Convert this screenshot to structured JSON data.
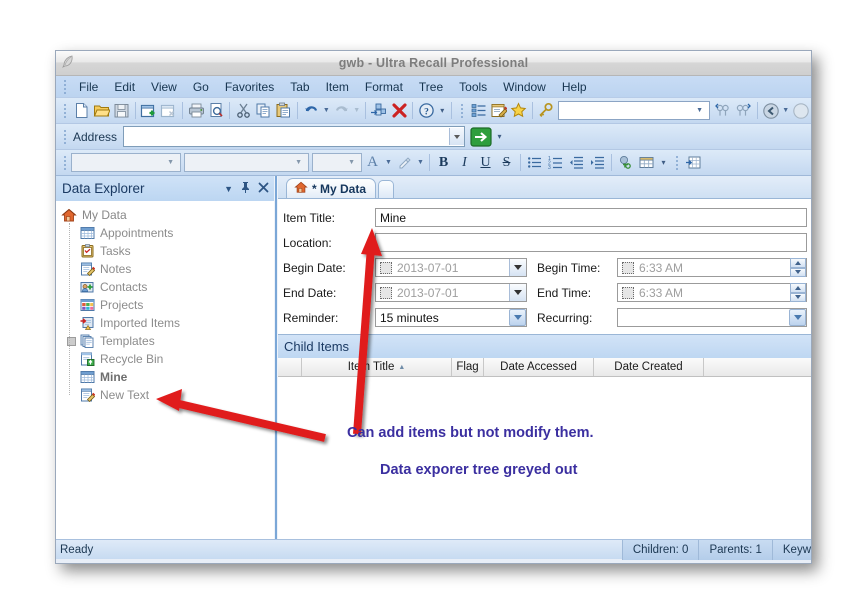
{
  "window": {
    "title": "gwb - Ultra Recall Professional",
    "app_icon": "feather-icon"
  },
  "menubar": {
    "items": [
      "File",
      "Edit",
      "View",
      "Go",
      "Favorites",
      "Tab",
      "Item",
      "Format",
      "Tree",
      "Tools",
      "Window",
      "Help"
    ]
  },
  "toolbar": {
    "buttons": [
      "new-document-icon",
      "open-folder-icon",
      "save-icon",
      "new-child-item-icon",
      "new-sibling-item-icon",
      "print-icon",
      "print-preview-icon",
      "cut-icon",
      "copy-icon",
      "paste-icon",
      "undo-icon",
      "redo-icon",
      "link-item-icon",
      "delete-icon",
      "help-icon"
    ],
    "right_buttons": [
      "list-view-icon",
      "edit-note-icon",
      "favorite-star-icon",
      "search-key-icon"
    ],
    "search_value": "",
    "nav_buttons": [
      "find-previous-icon",
      "find-next-icon",
      "back-icon"
    ]
  },
  "addressbar": {
    "label": "Address",
    "value": "",
    "placeholder": "",
    "go_label": "Go"
  },
  "formatbar": {
    "font_family": "",
    "font_style": "",
    "font_size": "",
    "buttons": [
      "font-color-icon",
      "highlight-color-icon",
      "bold-icon",
      "italic-icon",
      "underline-icon",
      "strikethrough-icon",
      "bullet-list-icon",
      "numbered-list-icon",
      "decrease-indent-icon",
      "increase-indent-icon",
      "hyperlink-icon",
      "insert-table-icon"
    ],
    "bold_label": "B",
    "italic_label": "I",
    "underline_label": "U",
    "strike_label": "S",
    "font_color_label": "A"
  },
  "sidebar": {
    "title": "Data Explorer",
    "header_icons": [
      "dropdown-menu-icon",
      "pin-icon",
      "close-icon"
    ],
    "tree": [
      {
        "label": "My Data",
        "icon": "home-icon",
        "depth": 0,
        "bold": false
      },
      {
        "label": "Appointments",
        "icon": "calendar-icon",
        "depth": 1,
        "bold": false
      },
      {
        "label": "Tasks",
        "icon": "clipboard-icon",
        "depth": 1,
        "bold": false
      },
      {
        "label": "Notes",
        "icon": "note-pencil-icon",
        "depth": 1,
        "bold": false
      },
      {
        "label": "Contacts",
        "icon": "contact-card-icon",
        "depth": 1,
        "bold": false
      },
      {
        "label": "Projects",
        "icon": "projects-grid-icon",
        "depth": 1,
        "bold": false
      },
      {
        "label": "Imported Items",
        "icon": "imported-items-icon",
        "depth": 1,
        "bold": false
      },
      {
        "label": "Templates",
        "icon": "templates-icon",
        "depth": 1,
        "bold": false
      },
      {
        "label": "Recycle Bin",
        "icon": "recycle-bin-icon",
        "depth": 1,
        "bold": false
      },
      {
        "label": "Mine",
        "icon": "calendar-icon",
        "depth": 1,
        "bold": true
      },
      {
        "label": "New Text",
        "icon": "note-pencil-icon",
        "depth": 1,
        "bold": false
      }
    ]
  },
  "main": {
    "tab": {
      "label": "* My Data",
      "icon": "home-icon"
    },
    "form": {
      "item_title": {
        "label": "Item Title:",
        "value": "Mine"
      },
      "location": {
        "label": "Location:",
        "value": ""
      },
      "begin_date": {
        "label": "Begin Date:",
        "value": "2013-07-01"
      },
      "end_date": {
        "label": "End Date:",
        "value": "2013-07-01"
      },
      "reminder": {
        "label": "Reminder:",
        "value": "15 minutes"
      },
      "begin_time": {
        "label": "Begin Time:",
        "value": "6:33 AM"
      },
      "end_time": {
        "label": "End Time:",
        "value": "6:33 AM"
      },
      "recurring": {
        "label": "Recurring:",
        "value": ""
      }
    },
    "child_items": {
      "title": "Child Items",
      "columns": [
        "",
        "Item Title",
        "Flag",
        "Date Accessed",
        "Date Created",
        ""
      ],
      "sort_column": "Item Title",
      "sort_direction": "ascending",
      "rows": []
    }
  },
  "statusbar": {
    "message": "Ready",
    "children": "Children: 0",
    "parents": "Parents: 1",
    "keywords": "Keyw"
  },
  "annotations": {
    "line1": "Can add items but not modify them.",
    "line2": "Data exporer tree greyed out",
    "color": "#3b2fa0",
    "arrow_color": "#e01b1b"
  }
}
